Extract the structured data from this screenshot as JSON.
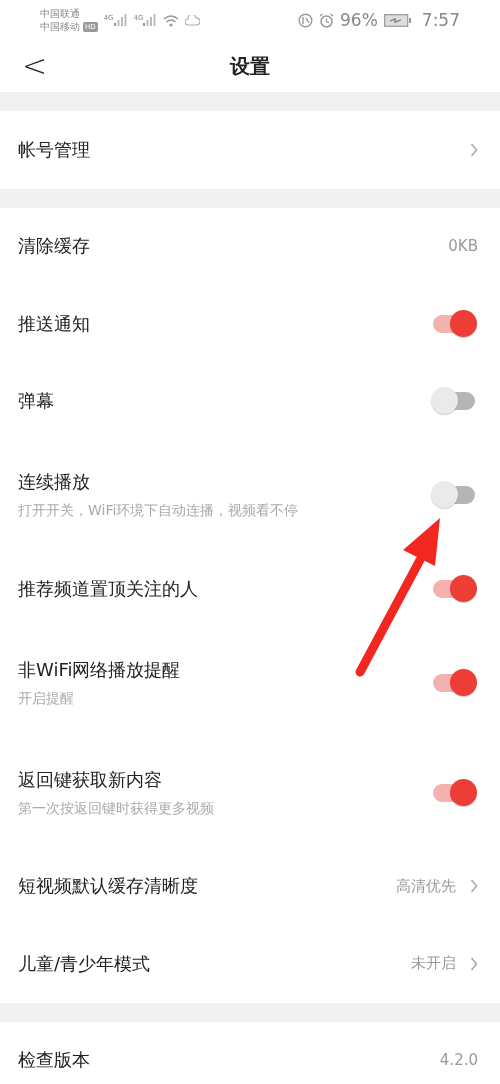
{
  "status_bar": {
    "carriers": [
      "中国联通",
      "中国移动"
    ],
    "hd_badge": "HD",
    "network": [
      "4G",
      "4G"
    ],
    "battery": "96%",
    "time": "7:57"
  },
  "header": {
    "back": "<",
    "title": "设置"
  },
  "groups": [
    {
      "items": [
        {
          "kind": "link",
          "label": "帐号管理",
          "value": null
        }
      ]
    },
    {
      "items": [
        {
          "kind": "value",
          "label": "清除缓存",
          "value": "0KB"
        },
        {
          "kind": "toggle",
          "label": "推送通知",
          "on": true
        },
        {
          "kind": "toggle",
          "label": "弹幕",
          "on": false
        },
        {
          "kind": "toggle",
          "label": "连续播放",
          "sub": "打开开关，WiFi环境下自动连播，视频看不停",
          "on": false
        },
        {
          "kind": "toggle",
          "label": "推荐频道置顶关注的人",
          "on": true
        },
        {
          "kind": "toggle",
          "label": "非WiFi网络播放提醒",
          "sub": "开启提醒",
          "on": true
        },
        {
          "kind": "toggle",
          "label": "返回键获取新内容",
          "sub": "第一次按返回键时获得更多视频",
          "on": true
        },
        {
          "kind": "link",
          "label": "短视频默认缓存清晰度",
          "value": "高清优先"
        },
        {
          "kind": "link",
          "label": "儿童/青少年模式",
          "value": "未开启"
        }
      ]
    },
    {
      "items": [
        {
          "kind": "value",
          "label": "检查版本",
          "value": "4.2.0"
        }
      ]
    }
  ]
}
